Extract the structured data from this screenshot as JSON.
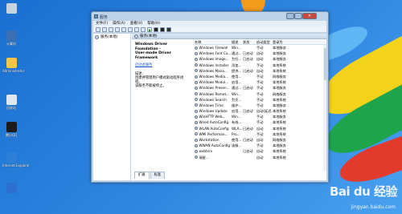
{
  "desktop": {
    "icons": [
      {
        "label": "",
        "icon": "computer-icon",
        "color": "#c9d3e0"
      },
      {
        "label": "计算机",
        "icon": "monitor-icon",
        "color": "#3a6fb3"
      },
      {
        "label": "Administrator",
        "icon": "folder-icon",
        "color": "#f0c64b"
      },
      {
        "label": "回收站",
        "icon": "recycle-bin-icon",
        "color": "#dfe8f2"
      },
      {
        "label": "腾讯QQ",
        "icon": "qq-icon",
        "color": "#1c1c1c"
      },
      {
        "label": "Internet Explorer",
        "icon": "ie-icon",
        "color": "#2d7fd8"
      },
      {
        "label": "",
        "icon": "shield-icon",
        "color": "#2d6fd0"
      }
    ]
  },
  "window": {
    "title": "服务",
    "menu": [
      "文件(F)",
      "操作(A)",
      "查看(V)",
      "帮助(H)"
    ],
    "tree": {
      "root_label": "服务(本地)"
    },
    "pane_header": "服务(本地)",
    "description": {
      "title_line1": "Windows Driver Foundation -",
      "title_line2": "User-mode Driver Framework",
      "action_link": "启动此服务",
      "label": "描述:",
      "text_line1": "创建并管理用户模式驱动程序进程。",
      "text_line2": "该服务不能被停止。"
    },
    "columns": [
      "名称",
      "描述",
      "状态",
      "启动类型",
      "登录为"
    ],
    "services": [
      {
        "name": "Windows Firewall",
        "desc": "Win...",
        "status": "",
        "startup": "手动",
        "logon": "本地服务"
      },
      {
        "name": "Windows Font Ca...",
        "desc": "通过...",
        "status": "已启动",
        "startup": "自动",
        "logon": "本地服务"
      },
      {
        "name": "Windows Image...",
        "desc": "为扫...",
        "status": "已启动",
        "startup": "自动",
        "logon": "本地服务"
      },
      {
        "name": "Windows Installer",
        "desc": "添加...",
        "status": "",
        "startup": "手动",
        "logon": "本地系统"
      },
      {
        "name": "Windows Mana...",
        "desc": "提供...",
        "status": "已启动",
        "startup": "自动",
        "logon": "本地系统"
      },
      {
        "name": "Windows Media...",
        "desc": "使用...",
        "status": "",
        "startup": "手动",
        "logon": "网络服务"
      },
      {
        "name": "Windows Modul...",
        "desc": "启用...",
        "status": "",
        "startup": "手动",
        "logon": "本地系统"
      },
      {
        "name": "Windows Presen...",
        "desc": "通过...",
        "status": "已启动",
        "startup": "手动",
        "logon": "本地服务"
      },
      {
        "name": "Windows Remot...",
        "desc": "Win...",
        "status": "",
        "startup": "手动",
        "logon": "网络服务"
      },
      {
        "name": "Windows Search",
        "desc": "为文...",
        "status": "",
        "startup": "手动",
        "logon": "本地系统"
      },
      {
        "name": "Windows Time",
        "desc": "维护...",
        "status": "",
        "startup": "手动",
        "logon": "本地服务"
      },
      {
        "name": "Windows Update",
        "desc": "启用...",
        "status": "已启动",
        "startup": "自动(延迟...",
        "logon": "本地系统"
      },
      {
        "name": "WinHTTP Web...",
        "desc": "Win...",
        "status": "",
        "startup": "手动",
        "logon": "本地服务"
      },
      {
        "name": "Wired AutoConfig",
        "desc": "有线...",
        "status": "",
        "startup": "手动",
        "logon": "本地系统"
      },
      {
        "name": "WLAN AutoConfig",
        "desc": "WLA...",
        "status": "已启动",
        "startup": "自动",
        "logon": "本地系统"
      },
      {
        "name": "WMI Performan...",
        "desc": "Pro...",
        "status": "",
        "startup": "手动",
        "logon": "本地系统"
      },
      {
        "name": "Workstation",
        "desc": "使用...",
        "status": "已启动",
        "startup": "自动",
        "logon": "网络服务"
      },
      {
        "name": "WWAN AutoConfig",
        "desc": "该服...",
        "status": "",
        "startup": "手动",
        "logon": "本地服务"
      },
      {
        "name": "wxbtsrv",
        "desc": "",
        "status": "已启动",
        "startup": "自动",
        "logon": "本地系统"
      },
      {
        "name": "瑞星...",
        "desc": "",
        "status": "",
        "startup": "自动",
        "logon": "本地系统"
      }
    ],
    "tabs": [
      "扩展",
      "标准"
    ]
  },
  "watermark": {
    "brand": "Bai du 经验",
    "url": "jingyan.baidu.com"
  }
}
